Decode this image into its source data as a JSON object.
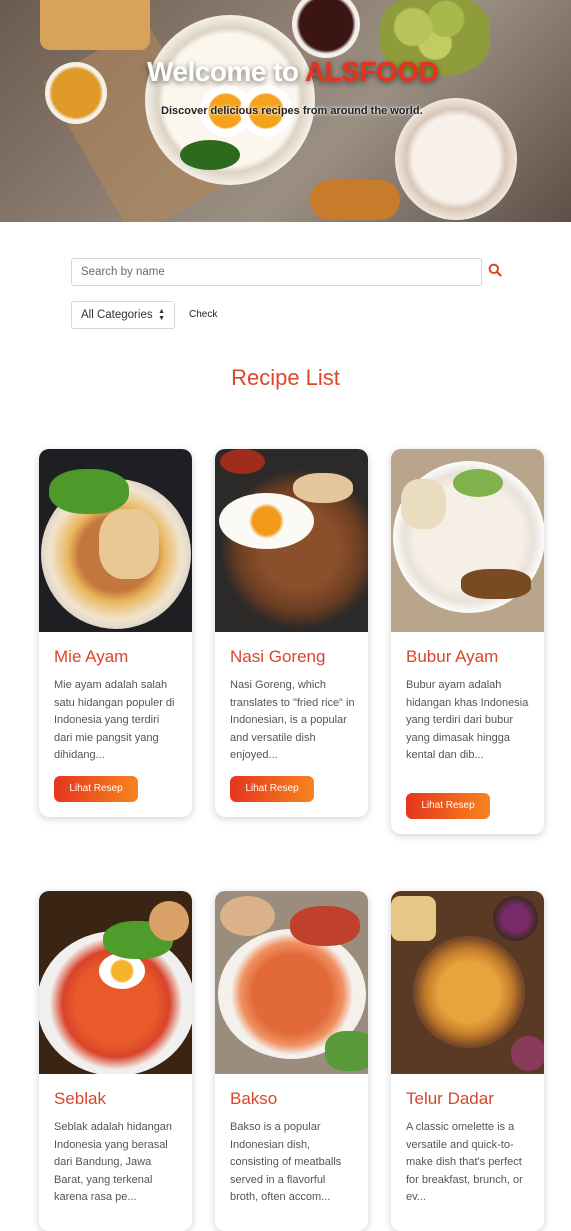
{
  "hero": {
    "title_prefix": "Welcome to ",
    "title_brand": "ALSFOOD",
    "subtitle": "Discover delicious recipes from around the world."
  },
  "search": {
    "placeholder": "Search by name",
    "icon": "search-icon"
  },
  "filter": {
    "category_selected": "All Categories",
    "check_label": "Check"
  },
  "section_title": "Recipe List",
  "button_label": "Lihat Resep",
  "recipes": [
    {
      "name": "Mie Ayam",
      "description": "Mie ayam adalah salah satu hidangan populer di Indonesia yang terdiri dari mie pangsit yang dihidang..."
    },
    {
      "name": "Nasi Goreng",
      "description": "Nasi Goreng, which translates to \"fried rice\" in Indonesian, is a popular and versatile dish enjoyed..."
    },
    {
      "name": "Bubur Ayam",
      "description": "Bubur ayam adalah hidangan khas Indonesia yang terdiri dari bubur yang dimasak hingga kental dan dib..."
    },
    {
      "name": "Seblak",
      "description": "Seblak adalah hidangan Indonesia yang berasal dari Bandung, Jawa Barat, yang terkenal karena rasa pe..."
    },
    {
      "name": "Bakso",
      "description": "Bakso is a popular Indonesian dish, consisting of meatballs served in a flavorful broth, often accom..."
    },
    {
      "name": "Telur Dadar",
      "description": "A classic omelette is a versatile and quick-to-make dish that's perfect for breakfast, brunch, or ev..."
    }
  ],
  "colors": {
    "accent": "#e0462a",
    "brand": "#e8321e",
    "button_start": "#e5361f",
    "button_end": "#f7841d"
  }
}
